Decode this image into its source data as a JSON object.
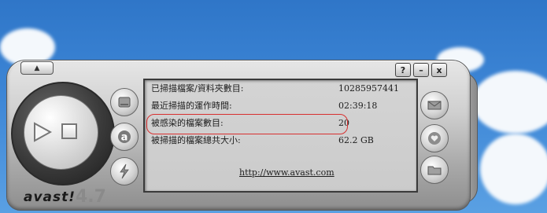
{
  "window": {
    "help_label": "?",
    "minimize_label": "–",
    "close_label": "x",
    "eject_label": "▲"
  },
  "brand": {
    "name": "avast!",
    "version": "4.7"
  },
  "stats": [
    {
      "label": "已掃描檔案/資料夾數目:",
      "value": "10285957441"
    },
    {
      "label": "最近掃描的運作時間:",
      "value": "02:39:18"
    },
    {
      "label": "被感染的檔案數目:",
      "value": "20"
    },
    {
      "label": "被掃描的檔案總共大小:",
      "value": "62.2 GB"
    }
  ],
  "link": {
    "text": "http://www.avast.com"
  },
  "colors": {
    "highlight": "#d83030",
    "sky": "#3d86d6"
  },
  "icons": {
    "left_column": [
      "hdd-icon",
      "avast-a-icon",
      "lightning-icon"
    ],
    "right_column": [
      "mail-icon",
      "heart-icon",
      "folder-icon"
    ],
    "dial": [
      "play-icon",
      "stop-icon"
    ]
  }
}
